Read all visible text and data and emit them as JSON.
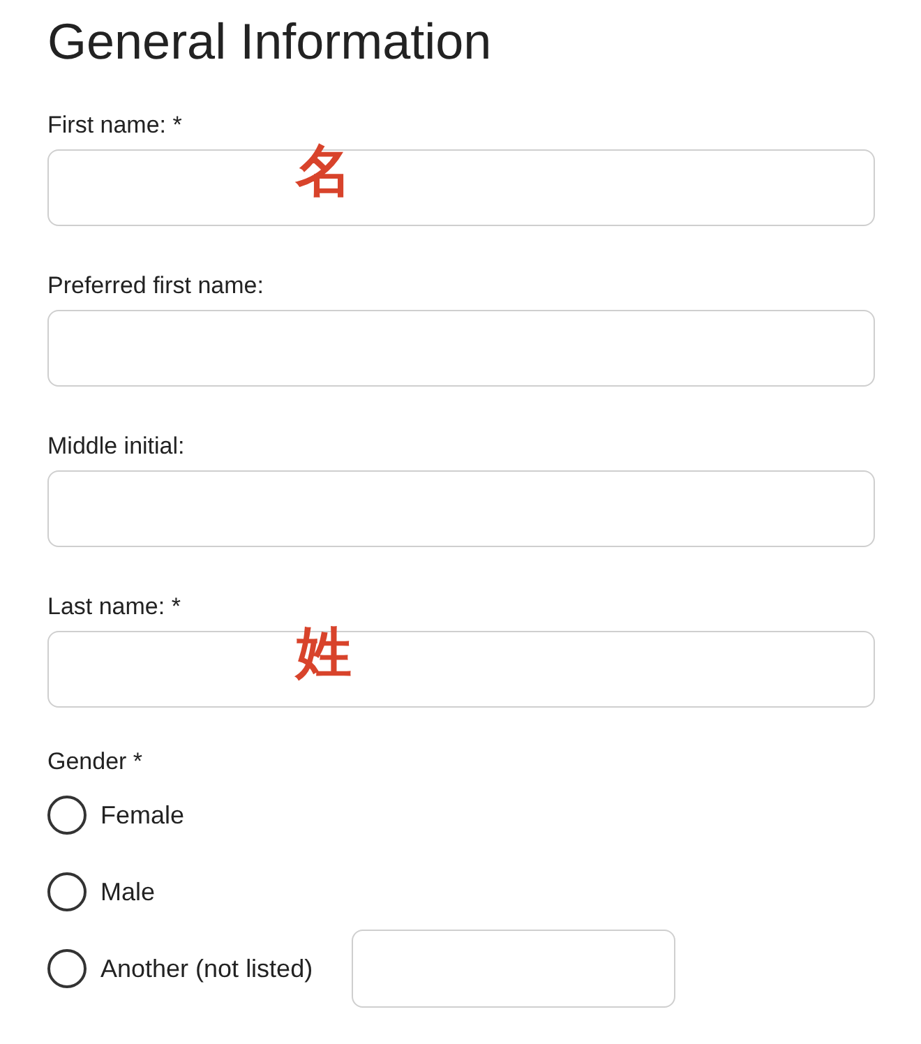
{
  "heading": "General Information",
  "fields": [
    {
      "label": "First name: *",
      "annotation": "名"
    },
    {
      "label": "Preferred first name:"
    },
    {
      "label": "Middle initial:"
    },
    {
      "label": "Last name: *",
      "annotation": "姓"
    }
  ],
  "gender": {
    "label": "Gender *",
    "options": [
      {
        "label": "Female",
        "selected": false,
        "kind": "plain"
      },
      {
        "label": "Male",
        "selected": false,
        "kind": "plain"
      },
      {
        "label": "Another (not listed)",
        "selected": false,
        "kind": "with-text"
      }
    ]
  }
}
